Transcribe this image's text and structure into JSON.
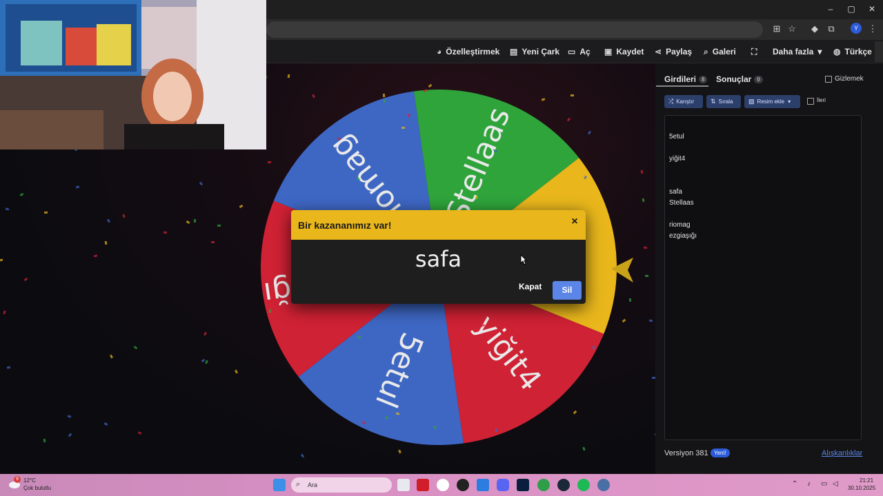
{
  "browser": {
    "window_controls": [
      "–",
      "▢",
      "✕"
    ]
  },
  "nav": {
    "customize": "Özelleştirmek",
    "new_wheel": "Yeni Çark",
    "open": "Aç",
    "save": "Kaydet",
    "share": "Paylaş",
    "gallery": "Galeri",
    "more": "Daha fazla",
    "language": "Türkçe"
  },
  "wheel": {
    "segments": [
      {
        "label": "riomag",
        "color": "#3e67c4"
      },
      {
        "label": "Stellaas",
        "color": "#2fa43b"
      },
      {
        "label": "safa",
        "color": "#e9b71c"
      },
      {
        "label": "yiğit4",
        "color": "#cf2234"
      },
      {
        "label": "5etul",
        "color": "#3e67c4"
      },
      {
        "label": "ezgiaşığı",
        "color": "#cf2234"
      }
    ]
  },
  "dialog": {
    "title": "Bir kazananımız var!",
    "close_icon": "×",
    "winner": "safa",
    "close_button": "Kapat",
    "delete_button": "Sil"
  },
  "panel": {
    "tab_entries": "Girdileri",
    "tab_entries_count": "8",
    "tab_results": "Sonuçlar",
    "tab_results_count": "0",
    "hide_label": "Gizlemek",
    "shuffle": "Karıştır",
    "sort": "Sırala",
    "add_image": "Resim ekle",
    "advanced": "İleri",
    "entries": [
      "5etul",
      "yiğit4",
      "safa",
      "Stellaas",
      "riomag",
      "ezgiaşığı"
    ],
    "version": "Versiyon 381",
    "new_badge": "Yeni!",
    "preferences": "Alışkanlıklar"
  },
  "taskbar": {
    "weather_badge": "9",
    "temperature": "12°C",
    "weather_desc": "Çok bulutlu",
    "search": "Ara",
    "time": "21:21",
    "date": "30.10.2025"
  },
  "colors": {
    "accent_blue": "#5b86e8",
    "dialog_header": "#e9b71c"
  }
}
